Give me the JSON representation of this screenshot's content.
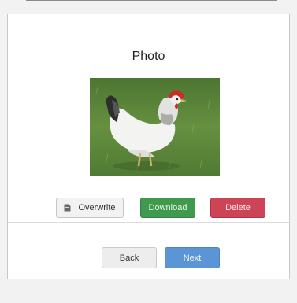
{
  "page": {
    "title": "Photo"
  },
  "actions": {
    "overwrite_label": "Overwrite",
    "download_label": "Download",
    "delete_label": "Delete"
  },
  "navigation": {
    "back_label": "Back",
    "next_label": "Next"
  },
  "icons": {
    "overwrite": "file-icon"
  },
  "colors": {
    "download": "#3f9a4e",
    "delete": "#cc4456",
    "next": "#5b95d6"
  }
}
